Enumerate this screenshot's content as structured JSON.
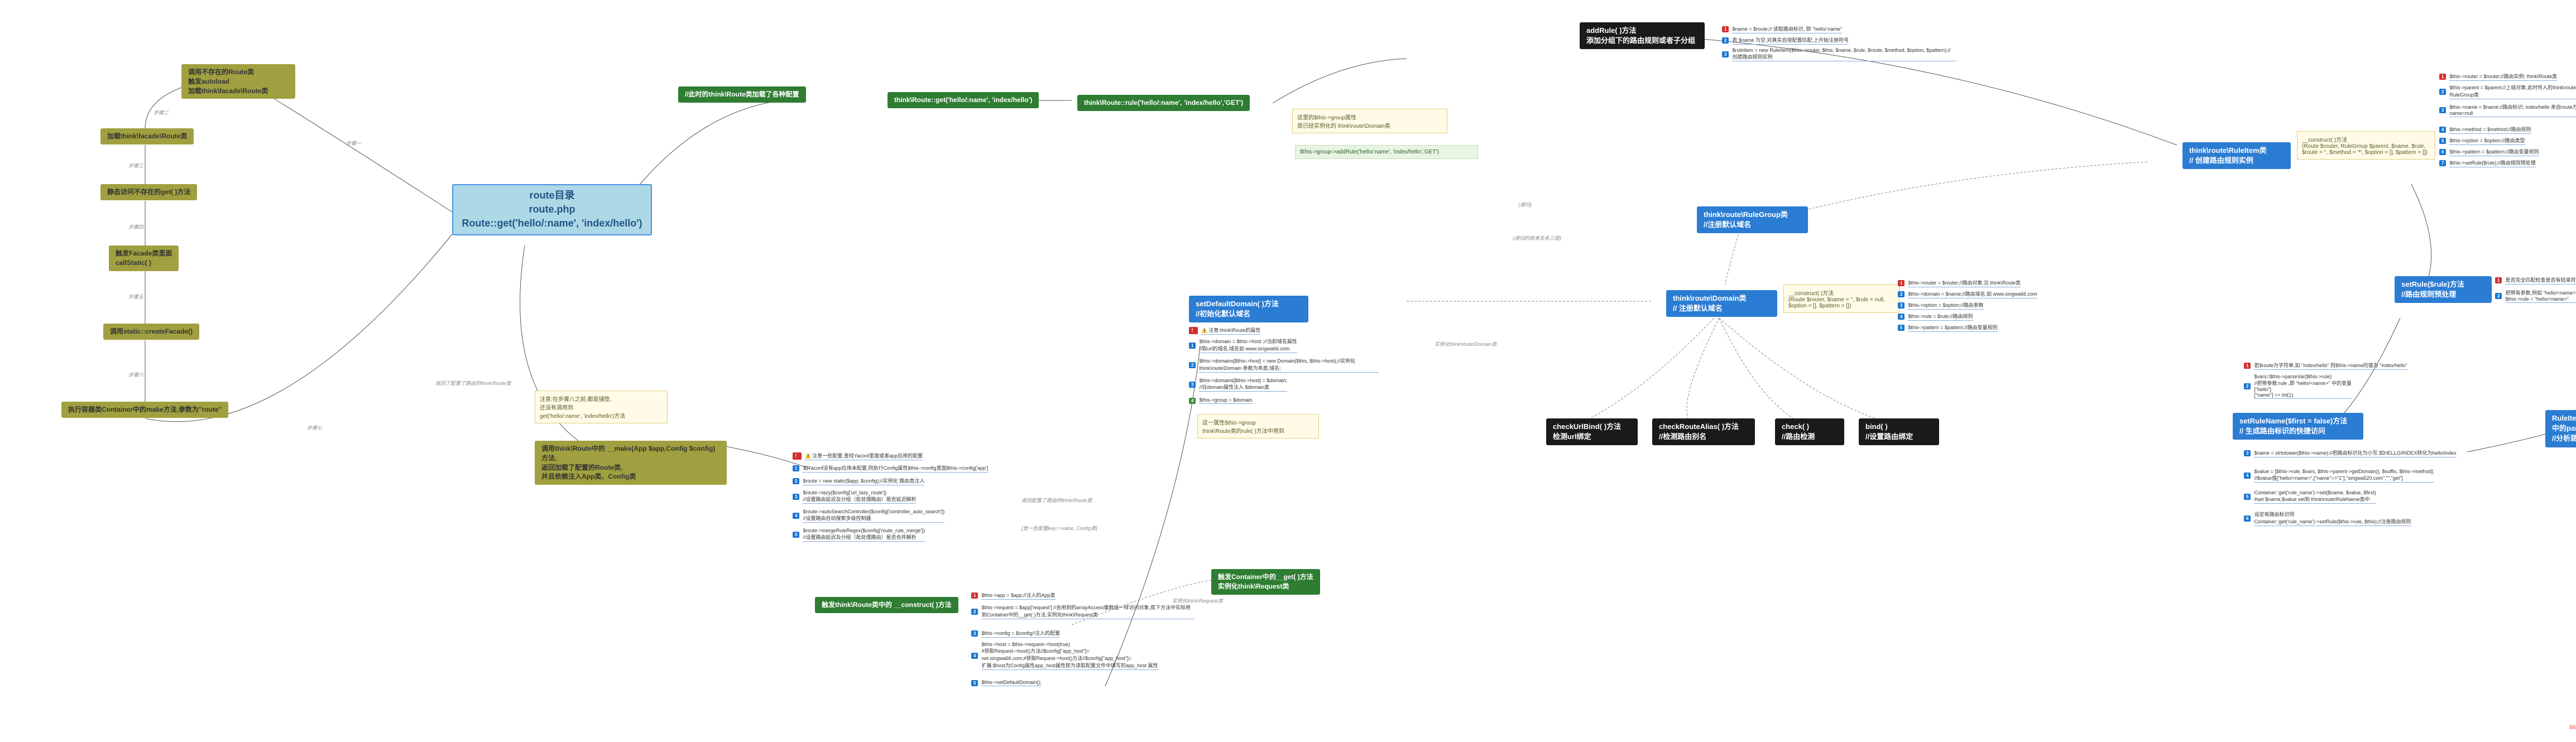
{
  "root": {
    "title_line1": "route目录",
    "title_line2": "route.php",
    "title_line3": "Route::get('hello/:name', 'index/hello')"
  },
  "left_chain": {
    "n1": "调用不存在的Route类\n触发autoload\n加载think\\facade\\Route类",
    "n2": "加载think\\facade\\Route类",
    "n3": "静态访问不存在的get( )方法",
    "n4": "触发Facade类里面\ncallStatic( )",
    "n5": "调用static::createFacade()",
    "n6": "执行容器类Container中的make方法,参数为\"route\""
  },
  "edge_labels": {
    "step1": "步骤一",
    "step2": "步骤二",
    "step3": "步骤三",
    "step4": "步骤四",
    "step5": "步骤五",
    "step6": "步骤六",
    "step7": "步骤七",
    "back_route": "返回了配置了路由的think\\Route类",
    "back_route2": "返回配置了路由的think\\Route类",
    "inst_domain": "实例化think\\route\\Domain类",
    "inst_request": "实例化think\\Request类",
    "recursion": "(递归)",
    "recursion2": "(递归的继承关系三层)",
    "config_arr": "[是一些配置key=>value, Config类]"
  },
  "mid": {
    "invoke_make": "调用think\\Route中的 __make(App $app,Config $config)方法,\n返回加载了配置的Route类,\n并且依赖注入App类、Config类",
    "note_before": "注意:在步骤八之前,都是铺垫,\n还没有调用到\nget('hello/:name', 'index/hello')方法",
    "upper_green1": "//此时的think\\Route类加载了各种配置",
    "upper_green2": "think\\Route::get('hello/:name', 'index/hello')",
    "upper_green3": "think\\Route::rule('hello/:name', 'index/hello','GET')"
  },
  "make_details": {
    "head_warn": "注意一些配置,查找Yaconf里面或者app应用的配置",
    "d1": "如Yaconf没有app应用未配置,则执行Config属性$this->config里面$this->config['app']",
    "d2": "$route = new static($app, $config);//实例化 路由类注入",
    "d3": "$route->lazy($config['url_lazy_route'])\n//设置路由延迟及分组（批处理路由）是否延迟解析",
    "d4": "$route->autoSearchController($config['controller_auto_search'])\n//设置路由自动搜索多级控制器",
    "d5": "$route->mergeRuleRegex($config['route_rule_merge'])\n//设置路由延迟及分组（批处理路由）是否合并解析"
  },
  "construct": {
    "title": "触发think\\Route类中的 __construct( )方法",
    "d1": "$this->app = $app;//注入的App类",
    "d2": "$this->request = $app['request'] //含用到的arrayAccess像数组一样访问对象,底下方法中实际用到Container中的__get( )方法,实例化think\\Request类",
    "d3": "$this->config = $config//注入的配置",
    "d4": "$this->host = $this->request->host(true)\n#获取Request->host()方法//$config[\"app_host\"]=\nnet.singwa66.com,#获取Request->host()方法//$config[\"app_host\"]=\n扩展:$host为Config属性app_host属性即为读取配置文件中填写的app_host 属性",
    "d5": "$this->setDefaultDomain();"
  },
  "container_get": {
    "title": "触发Container中的__get( )方法\n实例化think\\Request类"
  },
  "setDefaultDomain": {
    "title": "setDefaultDomain( )方法\n//初始化默认域名",
    "d_warn": "注意:think\\Route的属性",
    "d1": "$this->domain = $this->host ;//当前域名属性\n//取url的域名,域名如 www.singwa66.com",
    "d2": "$this->domains[$this->host] = new Domain($this, $this->host);//实例化think\\route\\Domain 参数为本类,域名;",
    "d3": "$this->domains[$this->host] = $domain;\n//往domain属性注入 $domain类",
    "d4": "$this->group = $domain",
    "note": "这一属性$this->group\nthink\\Route类的rule( )方法中用到"
  },
  "addRule": {
    "title": "addRule( )方法\n添加分组下的路由规则或者子分组",
    "call": "$this->group->addRule('hello/:name', 'index/hello','GET')",
    "note": "这里的$this->group属性\n是已经实例化的 think\\route\\Domain类"
  },
  "domain": {
    "title": "think\\route\\Domain类\n// 注册默认域名",
    "construct_note": "__construct( )方法\n(Route $router, $name = '', $rule = null, $option = [], $pattern = [])",
    "d1": "$this->router = $router;//路由对象.见 think\\Route类",
    "d2": "$this->domain = $name;//路由域名,如 www.singwa66.com",
    "d3": "$this->option = $option;//路由参数",
    "d4": "$this->rule = $rule;//路由规则",
    "d5": "$this->pattern = $pattern;//路由变量规则"
  },
  "ruleGroup": {
    "title": "think\\route\\RuleGroup类\n//注册默认域名"
  },
  "ruleItem": {
    "title": "think\\route\\RuleItem类\n// 创建路由规则实例",
    "construct_note": "__construct( )方法\n(Route $router, RuleGroup $parent, $name, $rule, $route = '', $method = '*', $option = [], $pattern = [])",
    "d1": "$this->router = $router;//路由实例; think\\Route类",
    "d2": "$this->parent = $parent;//上级对象,此时传入的think\\route\\Domain类继承RuleGroup类",
    "d3": "$this->name = $name;//路由标识; index/hello  来自route方法中表单参数默认null;\nname=null",
    "d4": "$this->method = $method;//路由规则",
    "d5": "$this->option = $option;//路由类型",
    "d6": "$this->pattern = $pattern;//路由变量规则",
    "d7": "$this->setRule($rule);//路由规则预处理",
    "top_d1": "$name = $route;// 读取路由标识, 即 \"hello/:name\"",
    "top_d2": "若 $name 为空,对真实自增配置匹配,上开始注册符号",
    "top_d3": "$ruleItem = new RuleItem($this->router, $this, $name, $rule, $route, $method, $option, $pattern);// 创建路由规则实例"
  },
  "domainMethods": {
    "checkUrlBind": "checkUrlBind( )方法\n检测url绑定",
    "checkRouteAlias": "checkRouteAlias( )方法\n//检测路由别名",
    "check": "check( )\n//路由检测",
    "bind": "bind( )\n//设置路由绑定"
  },
  "setRule": {
    "title": "setRule($rule)方法\n//路由规则预处理",
    "d1": "是否完全匹配检查是否有结束符号$",
    "d2": "把带有参数,例如 \"hello/<name>\"\n$this->rule = \"hello/<name>\""
  },
  "setRuleName": {
    "title": "setRuleName($first = false)方法\n// 生成路由标识的快捷访问",
    "d1": "若$route为字符串,如 \"index/hello\" 则$this->name的值为 \"index/hello\"",
    "d2": "$vars=$this->parseVar($this->rule)\n//把带参数:rule ,即 \"hello/<name>\" 中的变量\n[\"hello\"]\n[\"name\"] => int(1)",
    "d3": "$name = strtolower($this->name);//把路由标识化为小写,如HELLO/INDEX转化为hello/index",
    "d4": "$value = [$this->rule, $vars, $this->parent->getDomain(), $suffix, $this->method];\n//$value值[\"hello/<name>\",[\"name\"=>\"1\"],\"singwa520.com\",\"\",\"get\"]",
    "d5": "Container::get('rule_name')->set($name, $value, $first)\n#set $name,$value set到 think\\route\\RuleName类中",
    "d6": "设定有路由标识则\nContainer::get('rule_name')->setRule($this->rule, $this);//注册路由规则"
  },
  "parseVar": {
    "title": "RuleItem的父类 Rule类\n中的parseVar( )方法\n//分析路由规则中的变量"
  },
  "footer": "Blink"
}
